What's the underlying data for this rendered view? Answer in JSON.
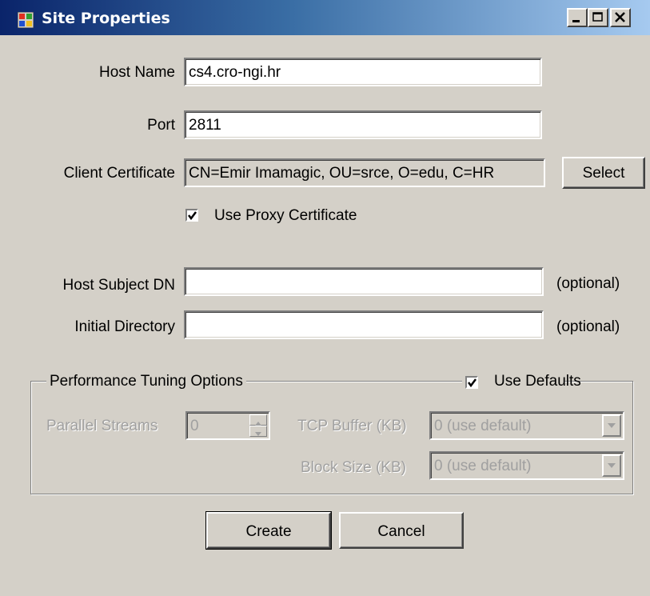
{
  "window": {
    "title": "Site Properties",
    "title_bar_color": "#0a246a"
  },
  "form": {
    "host_name_label": "Host Name",
    "host_name_value": "cs4.cro-ngi.hr",
    "port_label": "Port",
    "port_value": "2811",
    "client_cert_label": "Client Certificate",
    "client_cert_value": "CN=Emir Imamagic, OU=srce, O=edu, C=HR",
    "select_button": "Select",
    "use_proxy_label": "Use Proxy Certificate",
    "use_proxy_checked": true,
    "host_subject_label": "Host Subject DN",
    "host_subject_value": "",
    "host_subject_hint": "(optional)",
    "initial_dir_label": "Initial Directory",
    "initial_dir_value": "",
    "initial_dir_hint": "(optional)"
  },
  "performance": {
    "group_label": "Performance Tuning Options",
    "use_defaults_label": "Use Defaults",
    "use_defaults_checked": true,
    "parallel_streams_label": "Parallel Streams",
    "parallel_streams_value": "0",
    "tcp_buffer_label": "TCP Buffer (KB)",
    "tcp_buffer_value": "0 (use default)",
    "block_size_label": "Block Size (KB)",
    "block_size_value": "0 (use default)"
  },
  "buttons": {
    "create": "Create",
    "cancel": "Cancel"
  },
  "icons": {
    "app": "app-window-icon",
    "minimize": "minimize-icon",
    "maximize": "maximize-icon",
    "close": "close-icon",
    "check": "checkmark-icon",
    "dropdown": "chevron-down-icon",
    "spin_up": "spin-up-icon",
    "spin_down": "spin-down-icon"
  }
}
